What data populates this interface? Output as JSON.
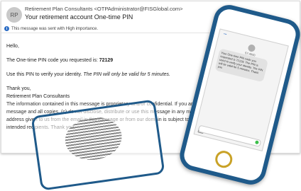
{
  "email": {
    "avatar_initials": "RP",
    "sender": "Retirement Plan Consultants <OTPAdministrator@FISGlobal.com>",
    "subject": "Your retirement account One-time PIN",
    "importance": "This message was sent with High importance.",
    "greeting": "Hello,",
    "pin_line_prefix": "The One-time PIN code you requested is: ",
    "pin_code": "72129",
    "verify_line_prefix": "Use this PIN to verify your identity. ",
    "verify_line_emph": "The PIN will only be valid for 5 minutes.",
    "signoff": "Thank you,",
    "signature": "Retirement Plan Consultants",
    "confidential_1": "The information contained in this message is proprietary and/or confidential. If you are not the",
    "confidential_2": "message and all copies. (c) do not disclose, distribute or use this message in any manner; and",
    "confidential_3": "address given to us from the email in this message or from our domain is subject to archiving",
    "confidential_4": "intended recipients. Thank you."
  },
  "phone": {
    "status_left": "•••",
    "contact_name": "57-4000",
    "message": "Your One-time PIN code you requested is 72129. The PIN is used to verify your identity. The PIN will be valid for 5 minutes. Thank you"
  },
  "colors": {
    "accent": "#1f5a8a",
    "home_button": "#c9a227",
    "send": "#3cbf4a"
  }
}
